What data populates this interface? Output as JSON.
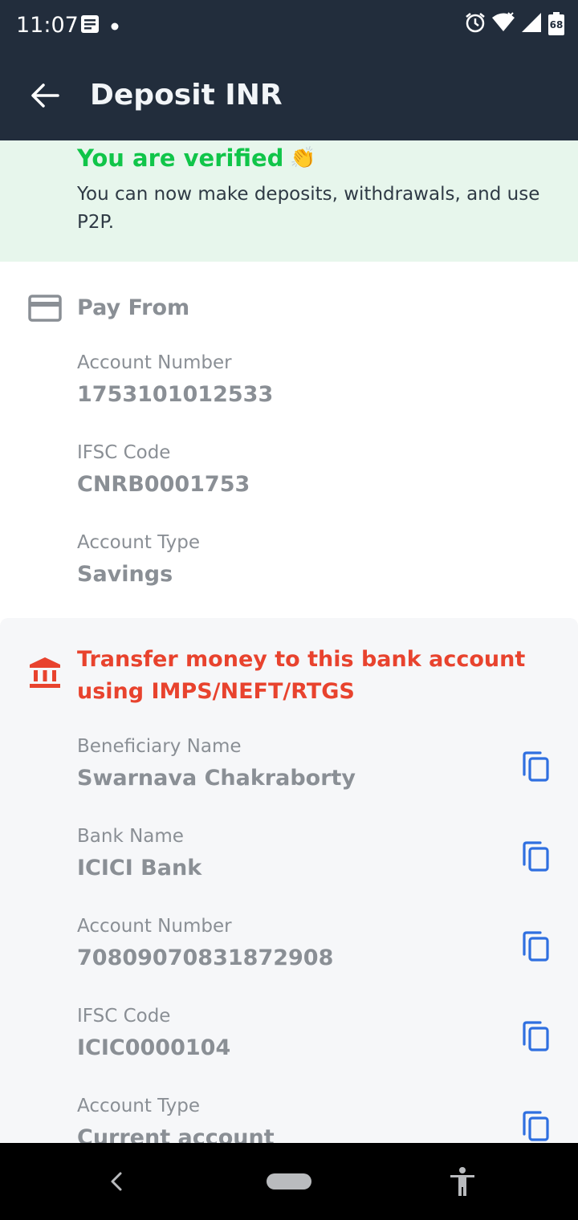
{
  "status_bar": {
    "time": "11:07",
    "battery": "68"
  },
  "app_bar": {
    "title": "Deposit INR"
  },
  "verified": {
    "title": "You are verified",
    "emoji": "👏",
    "message": "You can now make deposits, withdrawals, and use P2P."
  },
  "pay_from": {
    "title": "Pay From",
    "fields": [
      {
        "label": "Account Number",
        "value": "1753101012533"
      },
      {
        "label": "IFSC Code",
        "value": "CNRB0001753"
      },
      {
        "label": "Account Type",
        "value": "Savings"
      }
    ]
  },
  "transfer": {
    "title": "Transfer money to this bank account using IMPS/NEFT/RTGS",
    "fields": [
      {
        "label": "Beneficiary Name",
        "value": "Swarnava Chakraborty"
      },
      {
        "label": "Bank Name",
        "value": "ICICI Bank"
      },
      {
        "label": "Account Number",
        "value": "70809070831872908"
      },
      {
        "label": "IFSC Code",
        "value": "ICIC0000104"
      },
      {
        "label": "Account Type",
        "value": "Current account"
      }
    ]
  },
  "colors": {
    "app_bar": "#222d3c",
    "verified_green": "#10c549",
    "verified_bg": "#e7f6ec",
    "transfer_red": "#e8432e",
    "copy_blue": "#2f6fe0"
  }
}
